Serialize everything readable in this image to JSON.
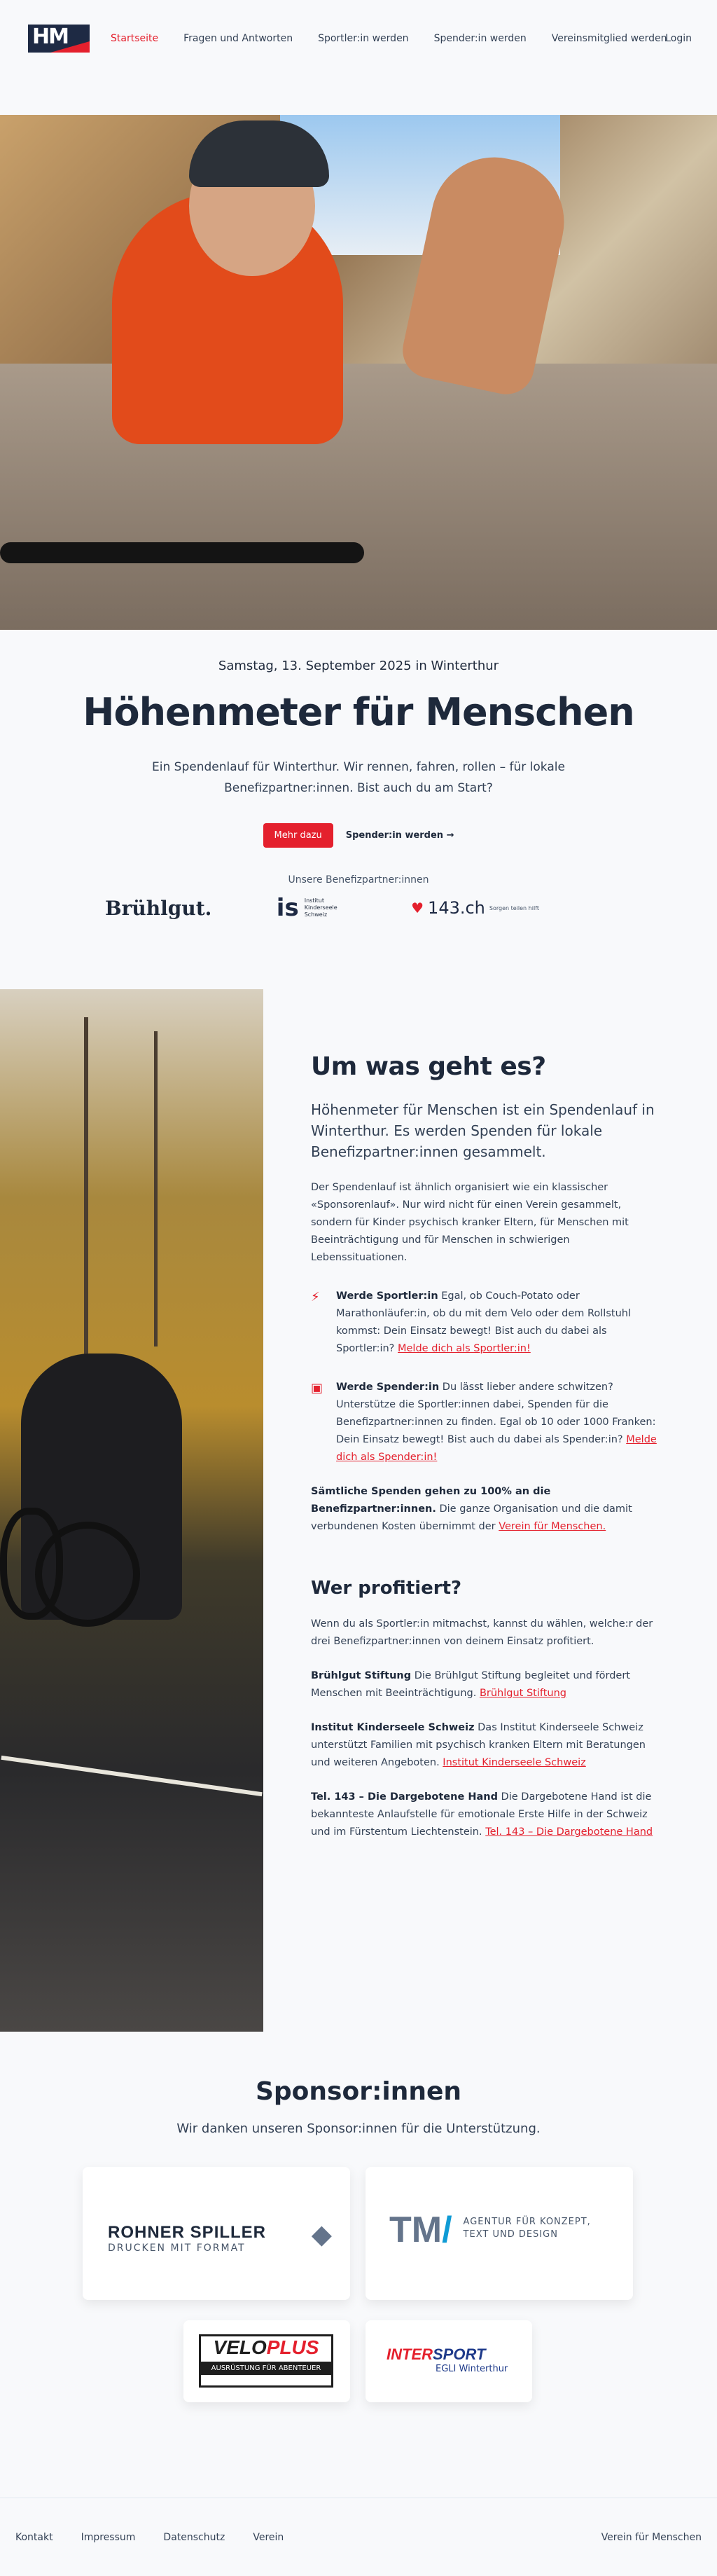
{
  "nav": {
    "logo_text": "HM",
    "items": [
      {
        "label": "Startseite",
        "active": true
      },
      {
        "label": "Fragen und Antworten",
        "active": false
      },
      {
        "label": "Sportler:in werden",
        "active": false
      },
      {
        "label": "Spender:in werden",
        "active": false
      },
      {
        "label": "Vereinsmitglied werden",
        "active": false
      }
    ],
    "login": "Login"
  },
  "hero": {
    "date": "Samstag, 13. September 2025 in Winterthur",
    "title": "Höhenmeter für Menschen",
    "subtitle": "Ein Spendenlauf für Winterthur. Wir rennen, fahren, rollen – für lokale Benefizpartner:innen. Bist auch du am Start?",
    "cta_primary": "Mehr dazu",
    "cta_secondary": "Spender:in werden →",
    "partners_label": "Unsere Benefizpartner:innen",
    "partners": {
      "bruehlgut": "Brühlgut.",
      "is_mark": "is",
      "is_text": "Institut Kinderseele Schweiz",
      "tel143": "143.ch",
      "tel143_sub": "Sorgen teilen hilft"
    }
  },
  "about": {
    "heading": "Um was geht es?",
    "lead": "Höhenmeter für Menschen ist ein Spendenlauf in Winterthur. Es werden Spenden für lokale Benefizpartner:innen gesammelt.",
    "text": "Der Spendenlauf ist ähnlich organisiert wie ein klassischer «Sponsorenlauf». Nur wird nicht für einen Verein gesammelt, sondern für Kinder psychisch kranker Eltern, für Menschen mit Beeinträchtigung und für Menschen in schwierigen Lebenssituationen.",
    "sportler_title": "Werde Sportler:in",
    "sportler_text": " Egal, ob Couch-Potato oder Marathonläufer:in, ob du mit dem Velo oder dem Rollstuhl kommst: Dein Einsatz bewegt! Bist auch du dabei als Sportler:in? ",
    "sportler_link": "Melde dich als Sportler:in!",
    "spender_title": "Werde Spender:in",
    "spender_text": " Du lässt lieber andere schwitzen? Unterstütze die Sportler:innen dabei, Spenden für die Benefizpartner:innen zu finden. Egal ob 10 oder 1000 Franken: Dein Einsatz bewegt! Bist auch du dabei als Spender:in? ",
    "spender_link": "Melde dich als Spender:in!",
    "total_bold": "Sämtliche Spenden gehen zu 100% an die Benefizpartner:innen.",
    "total_text": " Die ganze Organisation und die damit verbundenen Kosten übernimmt der ",
    "total_link": "Verein für Menschen."
  },
  "beneficiaries": {
    "heading": "Wer profitiert?",
    "intro": "Wenn du als Sportler:in mitmachst, kannst du wählen, welche:r der drei Benefizpartner:innen von deinem Einsatz profitiert.",
    "items": [
      {
        "name": "Brühlgut Stiftung",
        "text": " Die Brühlgut Stiftung begleitet und fördert Menschen mit Beeinträchtigung. ",
        "link": "Brühlgut Stiftung"
      },
      {
        "name": "Institut Kinderseele Schweiz",
        "text": " Das Institut Kinderseele Schweiz unterstützt Familien mit psychisch kranken Eltern mit Beratungen und weiteren Angeboten. ",
        "link": "Institut Kinderseele Schweiz"
      },
      {
        "name": "Tel. 143 – Die Dargebotene Hand",
        "text": " Die Dargebotene Hand ist die bekannteste Anlaufstelle für emotionale Erste Hilfe in der Schweiz und im Fürstentum Liechtenstein. ",
        "link": "Tel. 143 – Die Dargebotene Hand"
      }
    ]
  },
  "sponsors": {
    "heading": "Sponsor:innen",
    "subtitle": "Wir danken unseren Sponsor:innen für die Unterstützung.",
    "rohner_name": "ROHNER SPILLER",
    "rohner_sub": "DRUCKEN MIT FORMAT",
    "tm_mark": "TM",
    "tm_mark_slash": "/",
    "tm_text": "AGENTUR FÜR KONZEPT, TEXT UND DESIGN",
    "velo_a": "VELO",
    "velo_b": "PLUS",
    "velo_sub": "AUSRÜSTUNG FÜR ABENTEUER",
    "inter_a": "INTER",
    "inter_b": "SPORT",
    "inter_sub": "EGLI Winterthur"
  },
  "footer": {
    "links": [
      "Kontakt",
      "Impressum",
      "Datenschutz",
      "Verein"
    ],
    "right": "Verein für Menschen"
  }
}
